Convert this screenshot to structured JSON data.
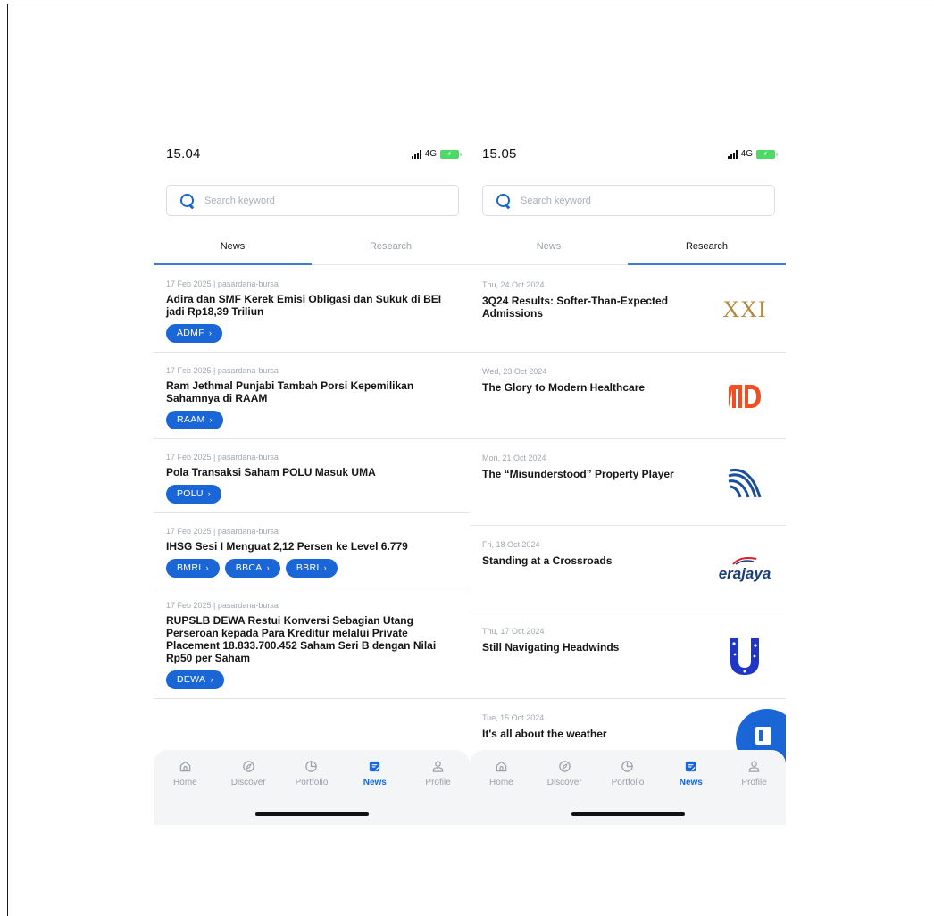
{
  "left": {
    "status": {
      "time": "15.04",
      "network": "4G"
    },
    "search": {
      "placeholder": "Search keyword"
    },
    "tabs": [
      {
        "label": "News"
      },
      {
        "label": "Research"
      }
    ],
    "news": [
      {
        "date": "17 Feb 2025",
        "source": "pasardana-bursa",
        "title": "Adira dan SMF Kerek Emisi Obligasi dan Sukuk di BEI jadi Rp18,39 Triliun",
        "tickers": [
          "ADMF"
        ]
      },
      {
        "date": "17 Feb 2025",
        "source": "pasardana-bursa",
        "title": "Ram Jethmal Punjabi Tambah Porsi Kepemilikan Sahamnya di RAAM",
        "tickers": [
          "RAAM"
        ]
      },
      {
        "date": "17 Feb 2025",
        "source": "pasardana-bursa",
        "title": "Pola Transaksi Saham POLU Masuk UMA",
        "tickers": [
          "POLU"
        ]
      },
      {
        "date": "17 Feb 2025",
        "source": "pasardana-bursa",
        "title": "IHSG Sesi I Menguat 2,12 Persen ke Level 6.779",
        "tickers": [
          "BMRI",
          "BBCA",
          "BBRI"
        ]
      },
      {
        "date": "17 Feb 2025",
        "source": "pasardana-bursa",
        "title": "RUPSLB DEWA Restui Konversi Sebagian Utang Perseroan kepada Para Kreditur melalui Private Placement 18.833.700.452 Saham Seri B dengan Nilai Rp50 per Saham",
        "tickers": [
          "DEWA"
        ]
      }
    ],
    "nav": [
      {
        "label": "Home",
        "icon": "home-icon"
      },
      {
        "label": "Discover",
        "icon": "compass-icon"
      },
      {
        "label": "Portfolio",
        "icon": "pie-chart-icon"
      },
      {
        "label": "News",
        "icon": "news-icon"
      },
      {
        "label": "Profile",
        "icon": "profile-icon"
      }
    ]
  },
  "right": {
    "status": {
      "time": "15.05",
      "network": "4G"
    },
    "search": {
      "placeholder": "Search keyword"
    },
    "tabs": [
      {
        "label": "News"
      },
      {
        "label": "Research"
      }
    ],
    "research": [
      {
        "date": "Thu, 24 Oct 2024",
        "title": "3Q24 Results: Softer-Than-Expected Admissions",
        "logo": "XXI"
      },
      {
        "date": "Wed, 23 Oct 2024",
        "title": "The Glory to Modern Healthcare",
        "logo": ""
      },
      {
        "date": "Mon, 21 Oct 2024",
        "title": "The “Misunderstood” Property Player",
        "logo": ""
      },
      {
        "date": "Fri, 18 Oct 2024",
        "title": "Standing at  a Crossroads",
        "logo": "erajaya"
      },
      {
        "date": "Thu, 17 Oct 2024",
        "title": "Still Navigating Headwinds",
        "logo": ""
      },
      {
        "date": "Tue, 15 Oct 2024",
        "title": "It's all about the weather",
        "logo": ""
      }
    ],
    "nav": [
      {
        "label": "Home",
        "icon": "home-icon"
      },
      {
        "label": "Discover",
        "icon": "compass-icon"
      },
      {
        "label": "Portfolio",
        "icon": "pie-chart-icon"
      },
      {
        "label": "News",
        "icon": "news-icon"
      },
      {
        "label": "Profile",
        "icon": "profile-icon"
      }
    ]
  },
  "colors": {
    "accent": "#1b66d6",
    "tab_indicator": "#3d7bd6",
    "battery": "#4cd964",
    "xxi_gold": "#b08a3a",
    "md_orange": "#f04e23"
  }
}
